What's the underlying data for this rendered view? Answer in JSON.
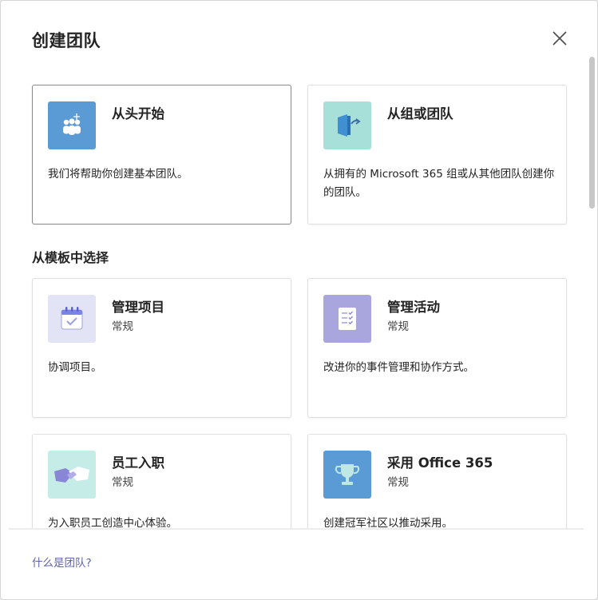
{
  "dialog": {
    "title": "创建团队",
    "close_label": "close"
  },
  "top_options": [
    {
      "name": "从头开始",
      "description": "我们将帮助你创建基本团队。",
      "icon": "people-plus-icon",
      "tile_color": "#5b9bd5"
    },
    {
      "name": "从组或团队",
      "description": "从拥有的 Microsoft 365 组或从其他团队创建你的团队。",
      "icon": "door-arrow-icon",
      "tile_color": "#a6e0d8"
    }
  ],
  "templates_section": {
    "label": "从模板中选择",
    "items": [
      {
        "name": "管理项目",
        "category": "常规",
        "description": "协调项目。",
        "icon": "calendar-check-icon",
        "tile_color": "#e2e4f5"
      },
      {
        "name": "管理活动",
        "category": "常规",
        "description": "改进你的事件管理和协作方式。",
        "icon": "checklist-icon",
        "tile_color": "#a8a6dc"
      },
      {
        "name": "员工入职",
        "category": "常规",
        "description": "为入职员工创造中心体验。",
        "icon": "handshake-icon",
        "tile_color": "#c6ece7"
      },
      {
        "name": "采用 Office 365",
        "category": "常规",
        "description": "创建冠军社区以推动采用。",
        "icon": "trophy-icon",
        "tile_color": "#5b9bd5"
      }
    ]
  },
  "footer": {
    "link_label": "什么是团队?"
  }
}
